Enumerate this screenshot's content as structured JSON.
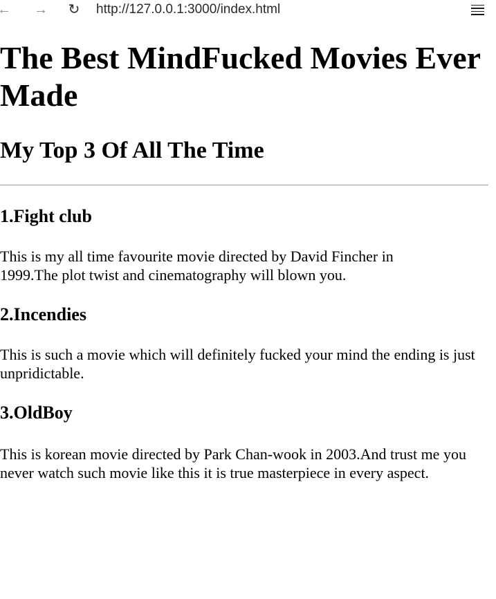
{
  "browser": {
    "back_icon": "←",
    "forward_icon": "→",
    "reload_icon": "↻",
    "url": "http://127.0.0.1:3000/index.html"
  },
  "page": {
    "title": "The Best MindFucked Movies Ever Made",
    "subtitle": "My Top 3 Of All The Time",
    "movies": [
      {
        "title": "1.Fight club",
        "description": "This is my all time favourite movie directed by David Fincher in 1999.The plot twist and cinematography will blown you."
      },
      {
        "title": "2.Incendies",
        "description": "This is such a movie which will definitely fucked your mind the ending is just unpridictable."
      },
      {
        "title": "3.OldBoy",
        "description": "This is korean movie directed by Park Chan-wook in 2003.And trust me you never watch such movie like this it is true masterpiece in every aspect."
      }
    ]
  }
}
